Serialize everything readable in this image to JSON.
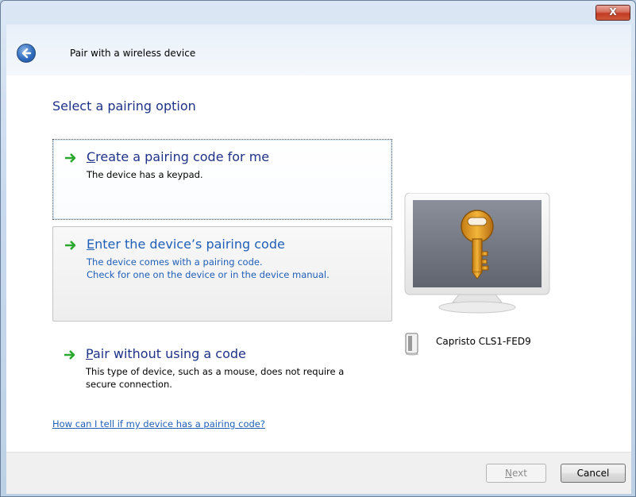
{
  "window": {
    "title": "Pair with a wireless device",
    "close_label": "X"
  },
  "heading": "Select a pairing option",
  "options": [
    {
      "title_access_key": "C",
      "title_rest": "reate a pairing code for me",
      "description": "The device has a keypad.",
      "state": "focused"
    },
    {
      "title_access_key": "E",
      "title_rest": "nter the device’s pairing code",
      "description": "The device comes with a pairing code.\nCheck for one on the device or in the device manual.",
      "state": "hovered"
    },
    {
      "title_access_key": "P",
      "title_rest": "air without using a code",
      "description": "This type of device, such as a mouse, does not require a\nsecure connection.",
      "state": "normal"
    }
  ],
  "help_link": "How can I tell if my device has a pairing code?",
  "device": {
    "name": "Capristo CLS1-FED9",
    "icon": "speaker-device-icon"
  },
  "buttons": {
    "next_access_key": "N",
    "next_rest": "ext",
    "next_enabled": false,
    "cancel": "Cancel"
  },
  "colors": {
    "heading": "#1e3287",
    "link": "#1f5fb8",
    "arrow": "#2aa830"
  }
}
